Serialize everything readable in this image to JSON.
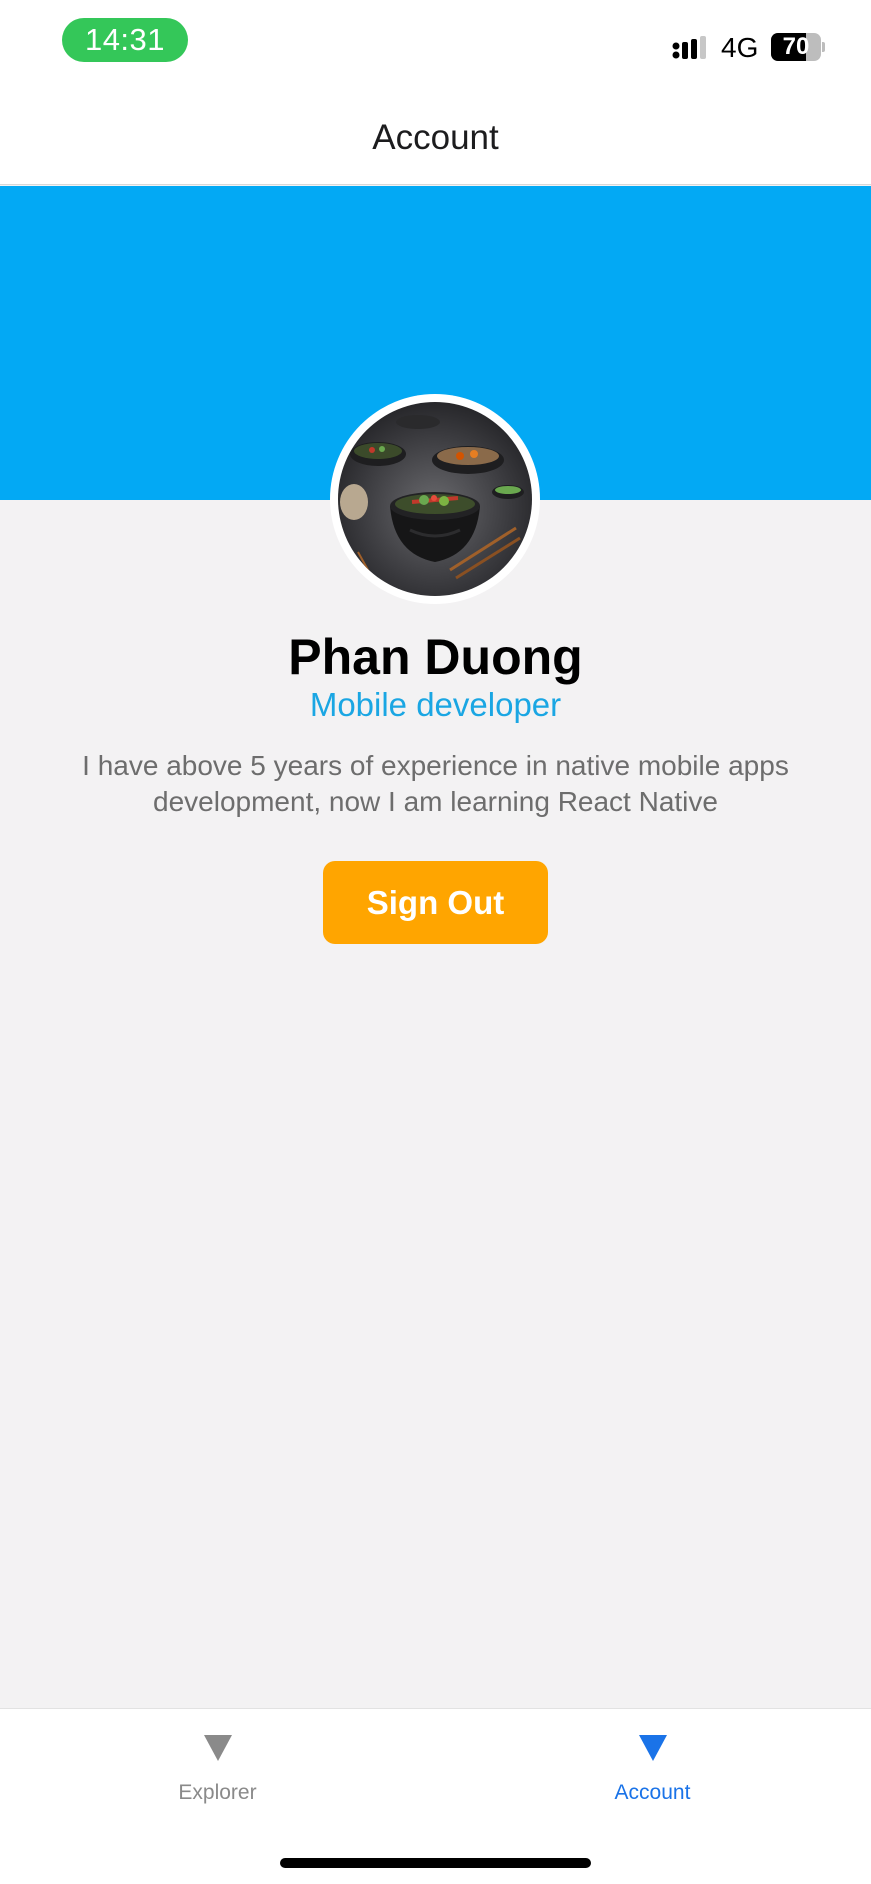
{
  "status_bar": {
    "time": "14:31",
    "network": "4G",
    "battery_level": "70",
    "battery_fraction": 0.7
  },
  "header": {
    "title": "Account"
  },
  "theme": {
    "banner_color": "#03a9f4",
    "accent": "#1aa6e3",
    "button_color": "#ffa500",
    "active_tab_color": "#1a73e8",
    "inactive_tab_color": "#8a8a8a"
  },
  "profile": {
    "name": "Phan Duong",
    "role": "Mobile developer",
    "bio": "I have above 5 years of experience in native mobile apps development, now I am learning React Native",
    "avatar_icon": "avatar-photo"
  },
  "actions": {
    "sign_out_label": "Sign Out"
  },
  "tabs": [
    {
      "label": "Explorer",
      "icon": "triangle-down-icon",
      "active": false
    },
    {
      "label": "Account",
      "icon": "triangle-down-icon",
      "active": true
    }
  ]
}
